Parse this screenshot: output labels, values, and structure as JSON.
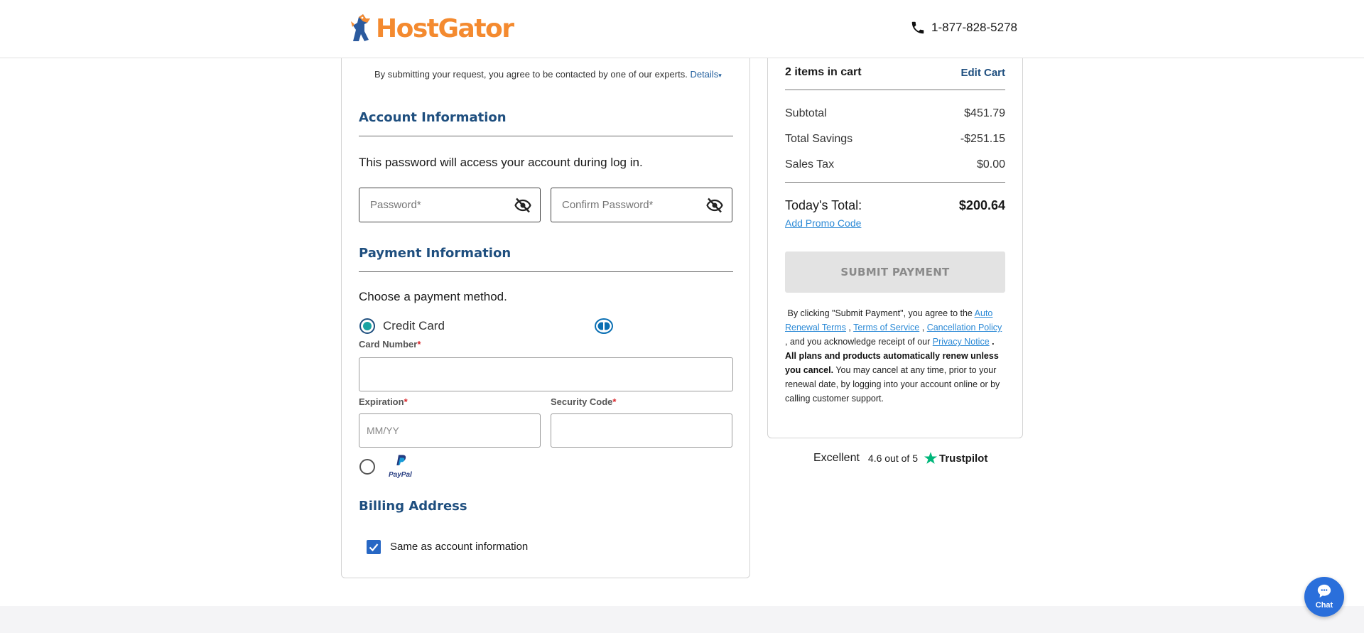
{
  "header": {
    "logo_text": "HostGator",
    "phone": "1-877-828-5278"
  },
  "form": {
    "consent_text": "By submitting your request, you agree to be contacted by one of our experts.",
    "consent_details": "Details",
    "account": {
      "title": "Account Information",
      "description": "This password will access your account during log in.",
      "password_placeholder": "Password*",
      "confirm_placeholder": "Confirm Password*"
    },
    "payment": {
      "title": "Payment Information",
      "description": "Choose a payment method.",
      "credit_card_label": "Credit Card",
      "card_number_label": "Card Number",
      "expiration_label": "Expiration",
      "expiration_placeholder": "MM/YY",
      "security_code_label": "Security Code",
      "required_mark": "*",
      "paypal_label": "PayPal"
    },
    "billing": {
      "title": "Billing Address",
      "same_as_account": "Same as account information"
    }
  },
  "cart": {
    "items_count": "2 items in cart",
    "edit_cart": "Edit Cart",
    "subtotal_label": "Subtotal",
    "subtotal_value": "$451.79",
    "savings_label": "Total Savings",
    "savings_value": "-$251.15",
    "tax_label": "Sales Tax",
    "tax_value": "$0.00",
    "total_label": "Today's Total:",
    "total_value": "$200.64",
    "promo_link": "Add Promo Code",
    "submit_label": "SUBMIT PAYMENT",
    "legal": {
      "p1": "By clicking \"Submit Payment\", you agree to the",
      "auto_renewal": "Auto Renewal Terms",
      "sep1": ",",
      "tos": "Terms of Service",
      "sep2": ",",
      "cancellation": "Cancellation Policy",
      "p2": ", and you acknowledge receipt of our",
      "privacy": "Privacy Notice",
      "p3_bold": ". All plans and products automatically renew unless you cancel.",
      "p4": "You may cancel at any time, prior to your renewal date, by logging into your account online or by calling customer support."
    }
  },
  "trustpilot": {
    "excellent": "Excellent",
    "rating": "4.6 out of 5",
    "brand": "Trustpilot"
  },
  "chat": {
    "label": "Chat"
  },
  "colors": {
    "brand_orange": "#f48a2f",
    "heading_blue": "#1f4f7f",
    "link_blue": "#2c8ad6",
    "chat_blue": "#2a6fdb",
    "trustpilot_green": "#00b67a"
  }
}
